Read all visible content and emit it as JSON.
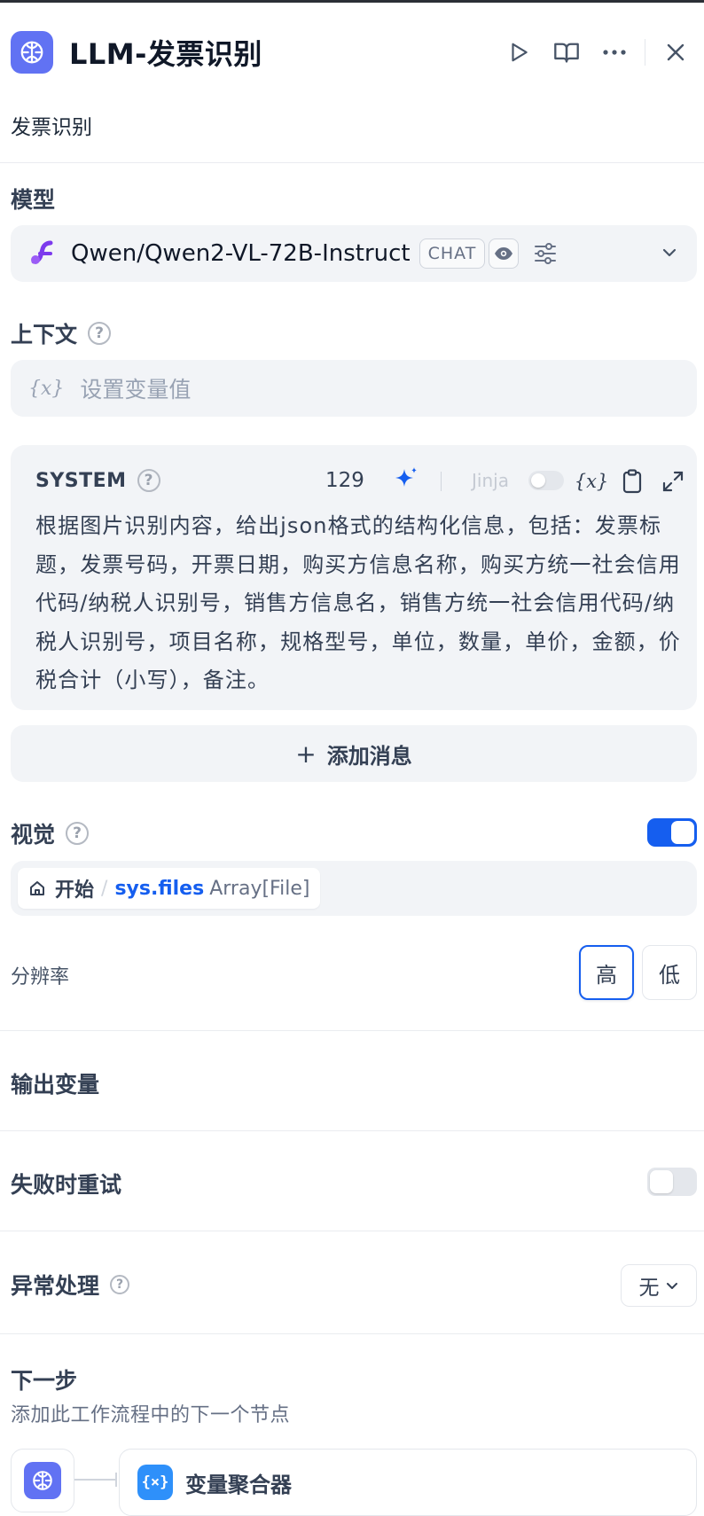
{
  "header": {
    "title": "LLM-发票识别",
    "description": "发票识别"
  },
  "model": {
    "section_label": "模型",
    "name": "Qwen/Qwen2-VL-72B-Instruct",
    "mode_badge": "CHAT"
  },
  "context": {
    "section_label": "上下文",
    "placeholder": "设置变量值",
    "glyph": "{x}"
  },
  "system_prompt": {
    "role_label": "SYSTEM",
    "char_count": "129",
    "jinja_label": "Jinja",
    "var_glyph": "{x}",
    "text": "根据图片识别内容，给出json格式的结构化信息，包括：发票标题，发票号码，开票日期，购买方信息名称，购买方统一社会信用代码/纳税人识别号，销售方信息名，销售方统一社会信用代码/纳税人识别号，项目名称，规格型号，单位，数量，单价，金额，价税合计（小写），备注。"
  },
  "add_message": {
    "plus": "+",
    "label": "添加消息"
  },
  "vision": {
    "section_label": "视觉",
    "enabled": true,
    "variable": {
      "node": "开始",
      "separator": "/",
      "name": "sys.files",
      "type": "Array[File]"
    },
    "resolution_label": "分辨率",
    "resolution_high": "高",
    "resolution_low": "低",
    "resolution_selected": "高"
  },
  "output": {
    "section_label": "输出变量"
  },
  "retry": {
    "section_label": "失败时重试",
    "enabled": false
  },
  "error_handling": {
    "section_label": "异常处理",
    "value": "无"
  },
  "next_step": {
    "section_label": "下一步",
    "subtitle": "添加此工作流程中的下一个节点",
    "next_node_icon": "{×}",
    "next_node_label": "变量聚合器"
  },
  "colors": {
    "accent": "#155eef",
    "node_icon_bg": "#6172f3",
    "aggregator_bg": "#2e90fa",
    "panel_bg": "#f2f4f7"
  },
  "icons": {
    "node": "brain-icon",
    "run": "play-icon",
    "docs": "book-open-icon",
    "more": "more-horizontal-icon",
    "close": "close-icon",
    "model_provider": "siliconflow-logo-icon",
    "vision_capability": "eye-icon",
    "model_params": "sliders-icon",
    "dropdown": "chevron-down-icon",
    "prompt_generator": "sparkle-icon",
    "insert_variable": "variable-icon",
    "copy": "clipboard-icon",
    "expand": "expand-icon",
    "start_node": "home-icon"
  }
}
